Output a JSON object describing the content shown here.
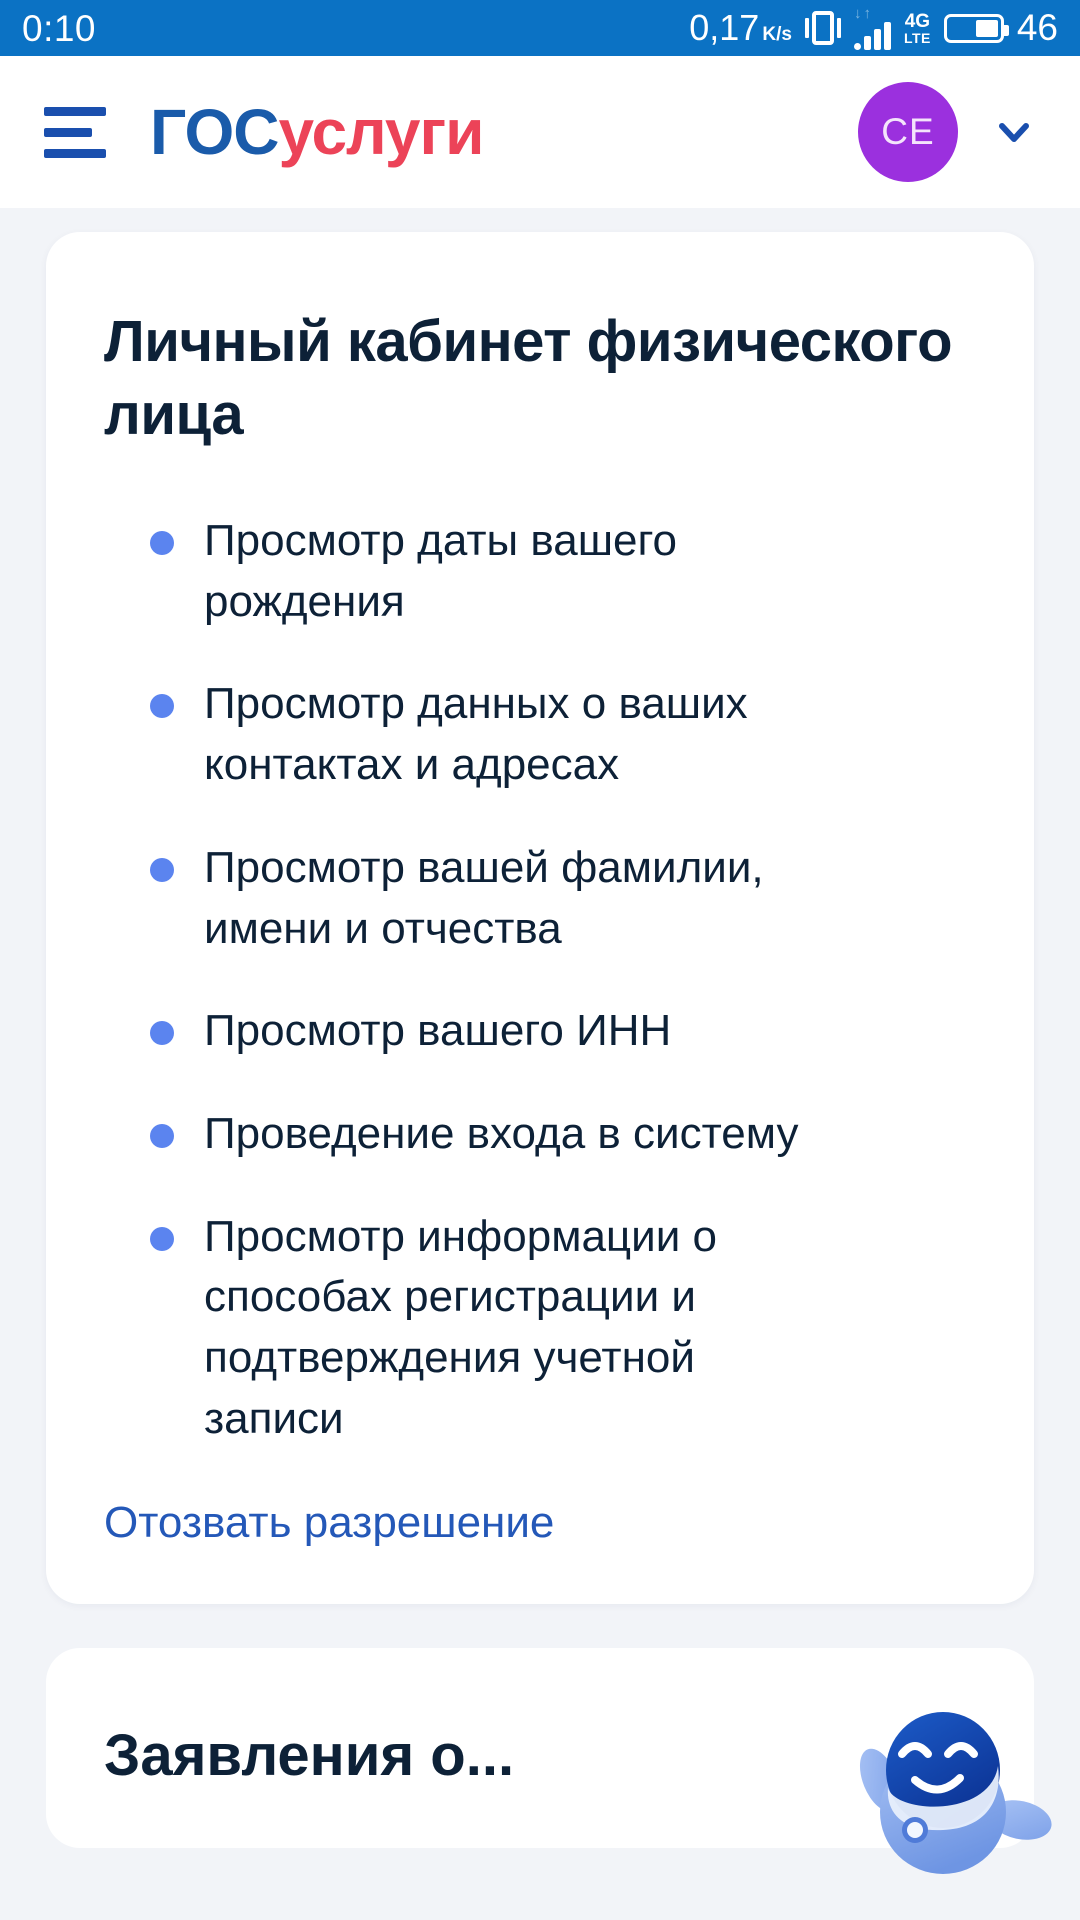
{
  "status_bar": {
    "time": "0:10",
    "network_speed": "0,17",
    "network_speed_unit_num": "K",
    "network_speed_unit_den": "s",
    "vibrate_icon": "vibrate-icon",
    "data_arrows_icon": "data-transfer-arrows-icon",
    "signal_icon": "signal-bars-icon",
    "network_type_primary": "4G",
    "network_type_secondary": "LTE",
    "battery_icon": "battery-icon",
    "battery_level": "46"
  },
  "header": {
    "menu_icon": "hamburger-menu-icon",
    "logo_part_blue": "ГОС",
    "logo_part_red": "услуги",
    "avatar_initials": "СЕ",
    "chevron_icon": "chevron-down-icon"
  },
  "main": {
    "card": {
      "title": "Личный кабинет физического лица",
      "permissions": [
        "Просмотр даты вашего рождения",
        "Просмотр данных о ваших контактах и адресах",
        "Просмотр вашей фамилии, имени и отчества",
        "Просмотр вашего ИНН",
        "Проведение входа в систему",
        "Просмотр информации о способах регистрации и подтверждения учетной записи"
      ],
      "revoke_link": "Отозвать разрешение"
    },
    "card_next": {
      "title_partial": "Заявления о..."
    }
  },
  "mascot": {
    "name": "robot-max-mascot"
  },
  "colors": {
    "status_bar_bg": "#0B72C4",
    "logo_blue": "#1A5BAA",
    "logo_red": "#EC4358",
    "avatar_purple": "#9B30DE",
    "bullet_blue": "#5B84EF",
    "link_blue": "#2458B8",
    "text_dark": "#0D2137",
    "page_bg": "#F2F4F8",
    "card_bg": "#FFFFFF",
    "mascot_head": "#0B3FA8",
    "mascot_body": "#8FB0EE"
  }
}
